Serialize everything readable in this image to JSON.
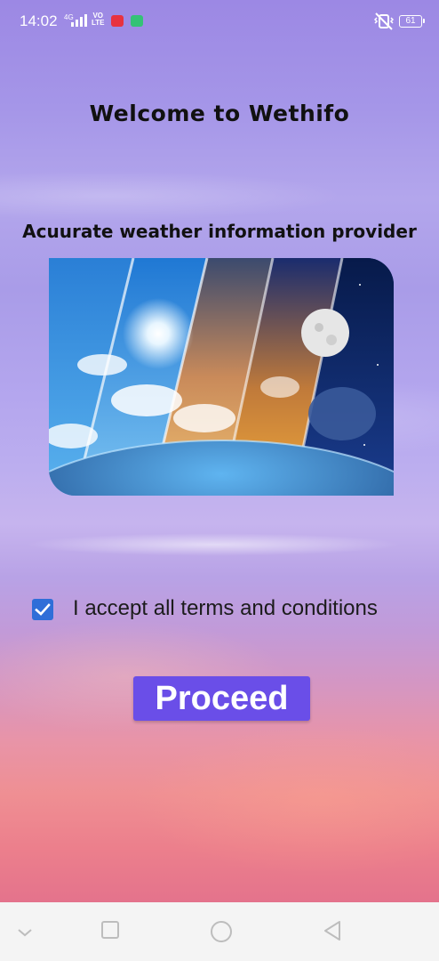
{
  "status_bar": {
    "time": "14:02",
    "network": "4G",
    "volte": [
      "VO",
      "LTE"
    ],
    "battery": "61",
    "icons": [
      "signal-icon",
      "volte-icon",
      "app-notification-icon",
      "message-notification-icon",
      "vibrate-icon",
      "battery-icon"
    ]
  },
  "welcome": {
    "title": "Welcome to Wethifo",
    "subtitle": "Acuurate weather information provider"
  },
  "terms": {
    "checked": true,
    "label": "I accept all terms and conditions"
  },
  "proceed_button": {
    "label": "Proceed",
    "color": "#6a4ee8"
  },
  "nav_bar": {
    "buttons": [
      "collapse-icon",
      "recents-icon",
      "home-icon",
      "back-icon"
    ]
  },
  "colors": {
    "checkbox": "#2f6ed8",
    "text": "#111111"
  }
}
